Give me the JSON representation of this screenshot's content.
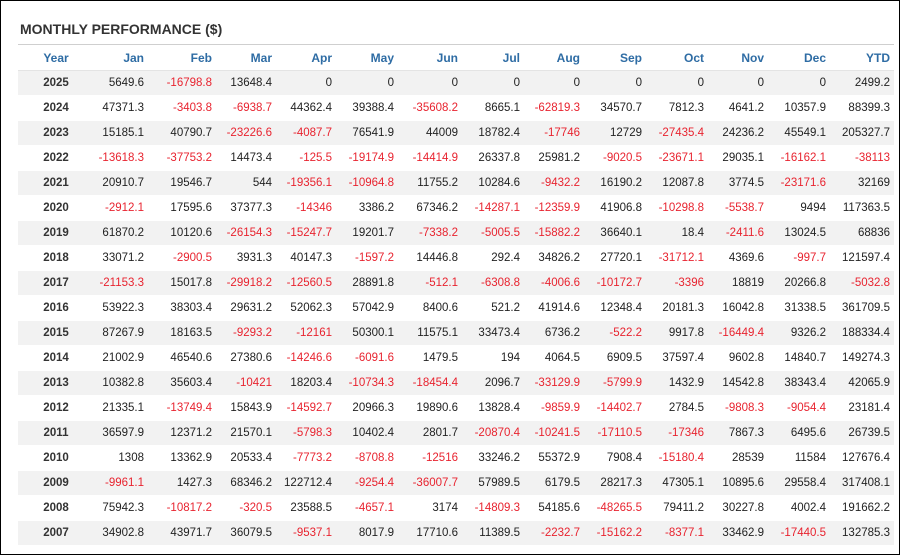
{
  "title": "MONTHLY PERFORMANCE ($)",
  "colors": {
    "header": "#2e6ca4",
    "negative": "#e8232f",
    "stripe": "#f2f2f2"
  },
  "chart_data": {
    "type": "table",
    "columns": [
      "Year",
      "Jan",
      "Feb",
      "Mar",
      "Apr",
      "May",
      "Jun",
      "Jul",
      "Aug",
      "Sep",
      "Oct",
      "Nov",
      "Dec",
      "YTD"
    ],
    "rows": [
      [
        "2025",
        "5649.6",
        "-16798.8",
        "13648.4",
        "0",
        "0",
        "0",
        "0",
        "0",
        "0",
        "0",
        "0",
        "0",
        "2499.2"
      ],
      [
        "2024",
        "47371.3",
        "-3403.8",
        "-6938.7",
        "44362.4",
        "39388.4",
        "-35608.2",
        "8665.1",
        "-62819.3",
        "34570.7",
        "7812.3",
        "4641.2",
        "10357.9",
        "88399.3"
      ],
      [
        "2023",
        "15185.1",
        "40790.7",
        "-23226.6",
        "-4087.7",
        "76541.9",
        "44009",
        "18782.4",
        "-17746",
        "12729",
        "-27435.4",
        "24236.2",
        "45549.1",
        "205327.7"
      ],
      [
        "2022",
        "-13618.3",
        "-37753.2",
        "14473.4",
        "-125.5",
        "-19174.9",
        "-14414.9",
        "26337.8",
        "25981.2",
        "-9020.5",
        "-23671.1",
        "29035.1",
        "-16162.1",
        "-38113"
      ],
      [
        "2021",
        "20910.7",
        "19546.7",
        "544",
        "-19356.1",
        "-10964.8",
        "11755.2",
        "10284.6",
        "-9432.2",
        "16190.2",
        "12087.8",
        "3774.5",
        "-23171.6",
        "32169"
      ],
      [
        "2020",
        "-2912.1",
        "17595.6",
        "37377.3",
        "-14346",
        "3386.2",
        "67346.2",
        "-14287.1",
        "-12359.9",
        "41906.8",
        "-10298.8",
        "-5538.7",
        "9494",
        "117363.5"
      ],
      [
        "2019",
        "61870.2",
        "10120.6",
        "-26154.3",
        "-15247.7",
        "19201.7",
        "-7338.2",
        "-5005.5",
        "-15882.2",
        "36640.1",
        "18.4",
        "-2411.6",
        "13024.5",
        "68836"
      ],
      [
        "2018",
        "33071.2",
        "-2900.5",
        "3931.3",
        "40147.3",
        "-1597.2",
        "14446.8",
        "292.4",
        "34826.2",
        "27720.1",
        "-31712.1",
        "4369.6",
        "-997.7",
        "121597.4"
      ],
      [
        "2017",
        "-21153.3",
        "15017.8",
        "-29918.2",
        "-12560.5",
        "28891.8",
        "-512.1",
        "-6308.8",
        "-4006.6",
        "-10172.7",
        "-3396",
        "18819",
        "20266.8",
        "-5032.8"
      ],
      [
        "2016",
        "53922.3",
        "38303.4",
        "29631.2",
        "52062.3",
        "57042.9",
        "8400.6",
        "521.2",
        "41914.6",
        "12348.4",
        "20181.3",
        "16042.8",
        "31338.5",
        "361709.5"
      ],
      [
        "2015",
        "87267.9",
        "18163.5",
        "-9293.2",
        "-12161",
        "50300.1",
        "11575.1",
        "33473.4",
        "6736.2",
        "-522.2",
        "9917.8",
        "-16449.4",
        "9326.2",
        "188334.4"
      ],
      [
        "2014",
        "21002.9",
        "46540.6",
        "27380.6",
        "-14246.6",
        "-6091.6",
        "1479.5",
        "194",
        "4064.5",
        "6909.5",
        "37597.4",
        "9602.8",
        "14840.7",
        "149274.3"
      ],
      [
        "2013",
        "10382.8",
        "35603.4",
        "-10421",
        "18203.4",
        "-10734.3",
        "-18454.4",
        "2096.7",
        "-33129.9",
        "-5799.9",
        "1432.9",
        "14542.8",
        "38343.4",
        "42065.9"
      ],
      [
        "2012",
        "21335.1",
        "-13749.4",
        "15843.9",
        "-14592.7",
        "20966.3",
        "19890.6",
        "13828.4",
        "-9859.9",
        "-14402.7",
        "2784.5",
        "-9808.3",
        "-9054.4",
        "23181.4"
      ],
      [
        "2011",
        "36597.9",
        "12371.2",
        "21570.1",
        "-5798.3",
        "10402.4",
        "2801.7",
        "-20870.4",
        "-10241.5",
        "-17110.5",
        "-17346",
        "7867.3",
        "6495.6",
        "26739.5"
      ],
      [
        "2010",
        "1308",
        "13362.9",
        "20533.4",
        "-7773.2",
        "-8708.8",
        "-12516",
        "33246.2",
        "55372.9",
        "7908.4",
        "-15180.4",
        "28539",
        "11584",
        "127676.4"
      ],
      [
        "2009",
        "-9961.1",
        "1427.3",
        "68346.2",
        "122712.4",
        "-9254.4",
        "-36007.7",
        "57989.5",
        "6179.5",
        "28217.3",
        "47305.1",
        "10895.6",
        "29558.4",
        "317408.1"
      ],
      [
        "2008",
        "75942.3",
        "-10817.2",
        "-320.5",
        "23588.5",
        "-4657.1",
        "3174",
        "-14809.3",
        "54185.6",
        "-48265.5",
        "79411.2",
        "30227.8",
        "4002.4",
        "191662.2"
      ],
      [
        "2007",
        "34902.8",
        "43971.7",
        "36079.5",
        "-9537.1",
        "8017.9",
        "17710.6",
        "11389.5",
        "-2232.7",
        "-15162.2",
        "-8377.1",
        "33462.9",
        "-17440.5",
        "132785.3"
      ]
    ]
  }
}
